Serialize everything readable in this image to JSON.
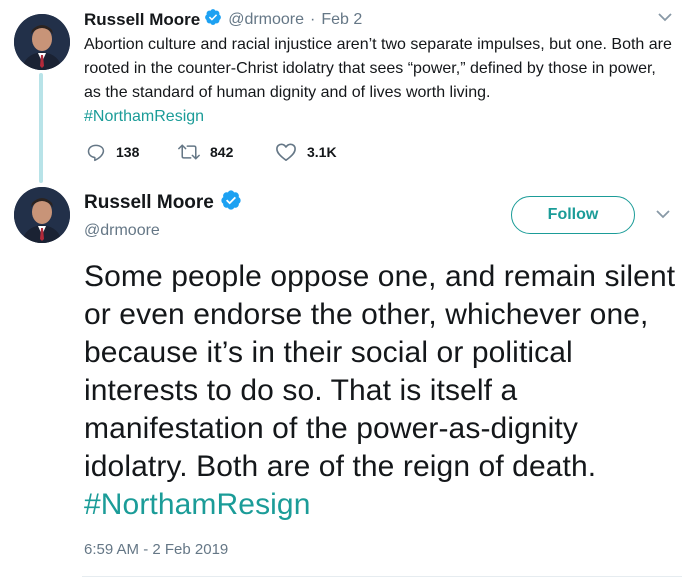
{
  "reply_tweet": {
    "author_name": "Russell Moore",
    "handle": "@drmoore",
    "separator": "·",
    "date": "Feb 2",
    "text": "Abortion culture and racial injustice aren’t two separate impulses, but one. Both are rooted in the counter-Christ idolatry that sees “power,” defined by those in power, as the standard of human dignity and of lives worth living.",
    "hashtag": "#NorthamResign",
    "replies": "138",
    "retweets": "842",
    "likes": "3.1K"
  },
  "main_tweet": {
    "author_name": "Russell Moore",
    "handle": "@drmoore",
    "follow_label": "Follow",
    "text": "Some people oppose one, and remain silent or even endorse the other, whichever one, because it’s in their social or political interests to do so. That is itself a manifestation of the power-as-dignity idolatry. Both are of the reign of death.",
    "hashtag": "#NorthamResign",
    "timestamp": "6:59 AM - 2 Feb 2019"
  },
  "colors": {
    "accent": "#1b9c98",
    "verified": "#1da1f2",
    "muted": "#657786",
    "thread_line": "#b8e3e8"
  },
  "icons": [
    "verified-icon",
    "chevron-down-icon",
    "reply-icon",
    "retweet-icon",
    "like-icon"
  ]
}
